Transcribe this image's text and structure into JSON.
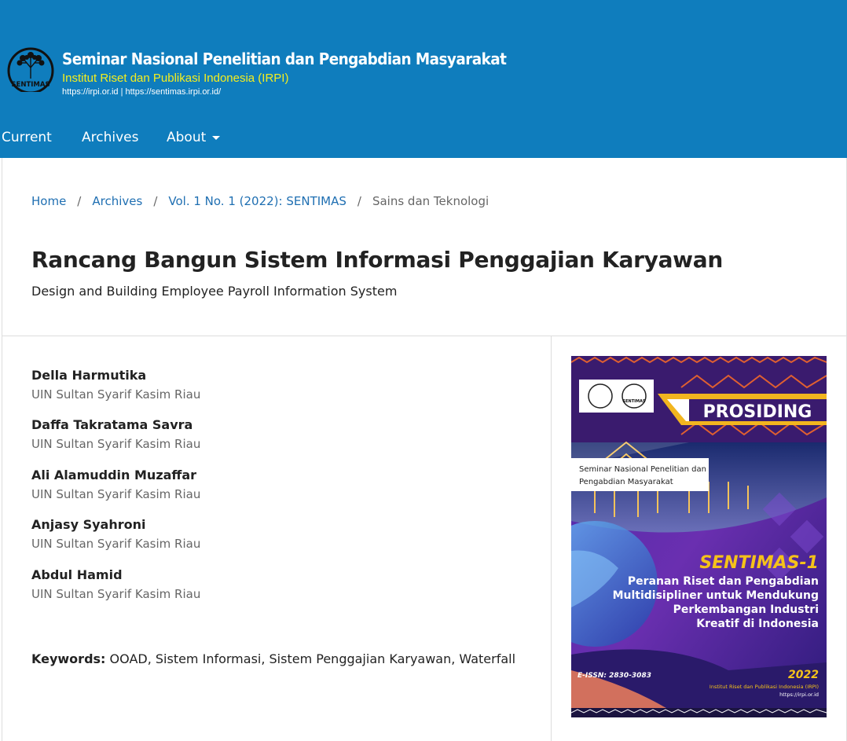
{
  "header": {
    "logo_text": "SENTIMAS",
    "title": "Seminar Nasional Penelitian dan Pengabdian Masyarakat",
    "org": "Institut Riset dan Publikasi Indonesia (IRPI)",
    "urls": "https://irpi.or.id | https://sentimas.irpi.or.id/",
    "color": "#0f7dbd",
    "org_color": "#f5ee1e"
  },
  "nav": {
    "items": [
      {
        "label": "Current"
      },
      {
        "label": "Archives"
      },
      {
        "label": "About",
        "icon": "caret-down-icon"
      }
    ]
  },
  "breadcrumb": {
    "items": [
      {
        "label": "Home"
      },
      {
        "label": "Archives"
      },
      {
        "label": "Vol. 1 No. 1 (2022): SENTIMAS"
      }
    ],
    "current": "Sains dan Teknologi",
    "separator": "/"
  },
  "article": {
    "title": "Rancang Bangun Sistem Informasi Penggajian Karyawan",
    "subtitle": "Design and Building Employee Payroll Information System",
    "authors": [
      {
        "name": "Della Harmutika",
        "affiliation": "UIN Sultan Syarif Kasim Riau"
      },
      {
        "name": "Daffa Takratama Savra",
        "affiliation": "UIN Sultan Syarif Kasim Riau"
      },
      {
        "name": "Ali Alamuddin Muzaffar",
        "affiliation": "UIN Sultan Syarif Kasim Riau"
      },
      {
        "name": "Anjasy Syahroni",
        "affiliation": "UIN Sultan Syarif Kasim Riau"
      },
      {
        "name": "Abdul Hamid",
        "affiliation": "UIN Sultan Syarif Kasim Riau"
      }
    ],
    "keywords_label": "Keywords:",
    "keywords": "OOAD, Sistem Informasi, Sistem Penggajian Karyawan, Waterfall"
  },
  "cover": {
    "banner": "PROSIDING",
    "seminar_line1": "Seminar Nasional Penelitian dan",
    "seminar_line2": "Pengabdian Masyarakat",
    "event": "SENTIMAS-1",
    "theme_line1": "Peranan Riset dan Pengabdian",
    "theme_line2": "Multidisipliner untuk Mendukung",
    "theme_line3": "Perkembangan Industri",
    "theme_line4": "Kreatif di Indonesia",
    "issn": "E-ISSN: 2830-3083",
    "year": "2022",
    "publisher": "Institut Riset dan Publikasi Indonesia (IRPI)",
    "url": "https://irpi.or.id",
    "logo_label": "SENTIMAS"
  }
}
